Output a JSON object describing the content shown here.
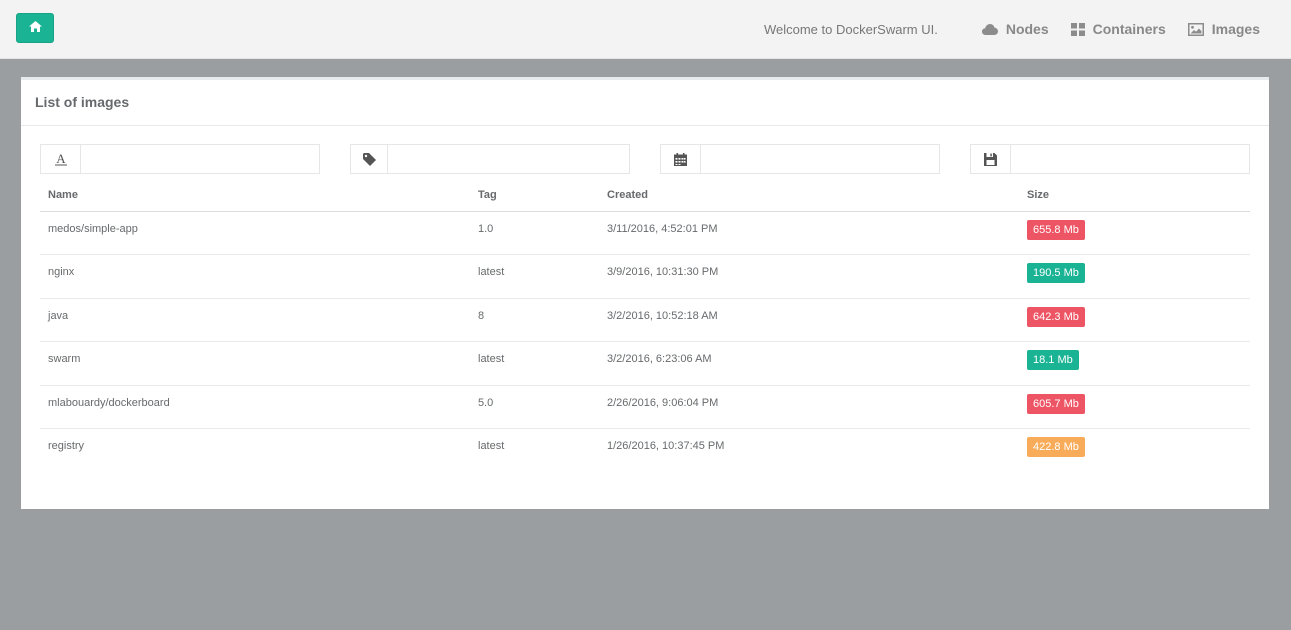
{
  "header": {
    "welcome": "Welcome to DockerSwarm UI.",
    "nav": [
      {
        "label": "Nodes",
        "icon": "cloud-icon"
      },
      {
        "label": "Containers",
        "icon": "grid-icon"
      },
      {
        "label": "Images",
        "icon": "image-icon"
      }
    ],
    "home_icon": "home-icon"
  },
  "panel": {
    "title": "List of images"
  },
  "filters": [
    {
      "icon": "font-icon",
      "value": ""
    },
    {
      "icon": "tag-icon",
      "value": ""
    },
    {
      "icon": "calendar-icon",
      "value": ""
    },
    {
      "icon": "save-icon",
      "value": ""
    }
  ],
  "table": {
    "columns": [
      "Name",
      "Tag",
      "Created",
      "Size"
    ],
    "rows": [
      {
        "name": "medos/simple-app",
        "tag": "1.0",
        "created": "3/11/2016, 4:52:01 PM",
        "size": "655.8 Mb",
        "color": "#ed5565"
      },
      {
        "name": "nginx",
        "tag": "latest",
        "created": "3/9/2016, 10:31:30 PM",
        "size": "190.5 Mb",
        "color": "#1ab394"
      },
      {
        "name": "java",
        "tag": "8",
        "created": "3/2/2016, 10:52:18 AM",
        "size": "642.3 Mb",
        "color": "#ed5565"
      },
      {
        "name": "swarm",
        "tag": "latest",
        "created": "3/2/2016, 6:23:06 AM",
        "size": "18.1 Mb",
        "color": "#1ab394"
      },
      {
        "name": "mlabouardy/dockerboard",
        "tag": "5.0",
        "created": "2/26/2016, 9:06:04 PM",
        "size": "605.7 Mb",
        "color": "#ed5565"
      },
      {
        "name": "registry",
        "tag": "latest",
        "created": "1/26/2016, 10:37:45 PM",
        "size": "422.8 Mb",
        "color": "#f8ac59"
      }
    ]
  }
}
